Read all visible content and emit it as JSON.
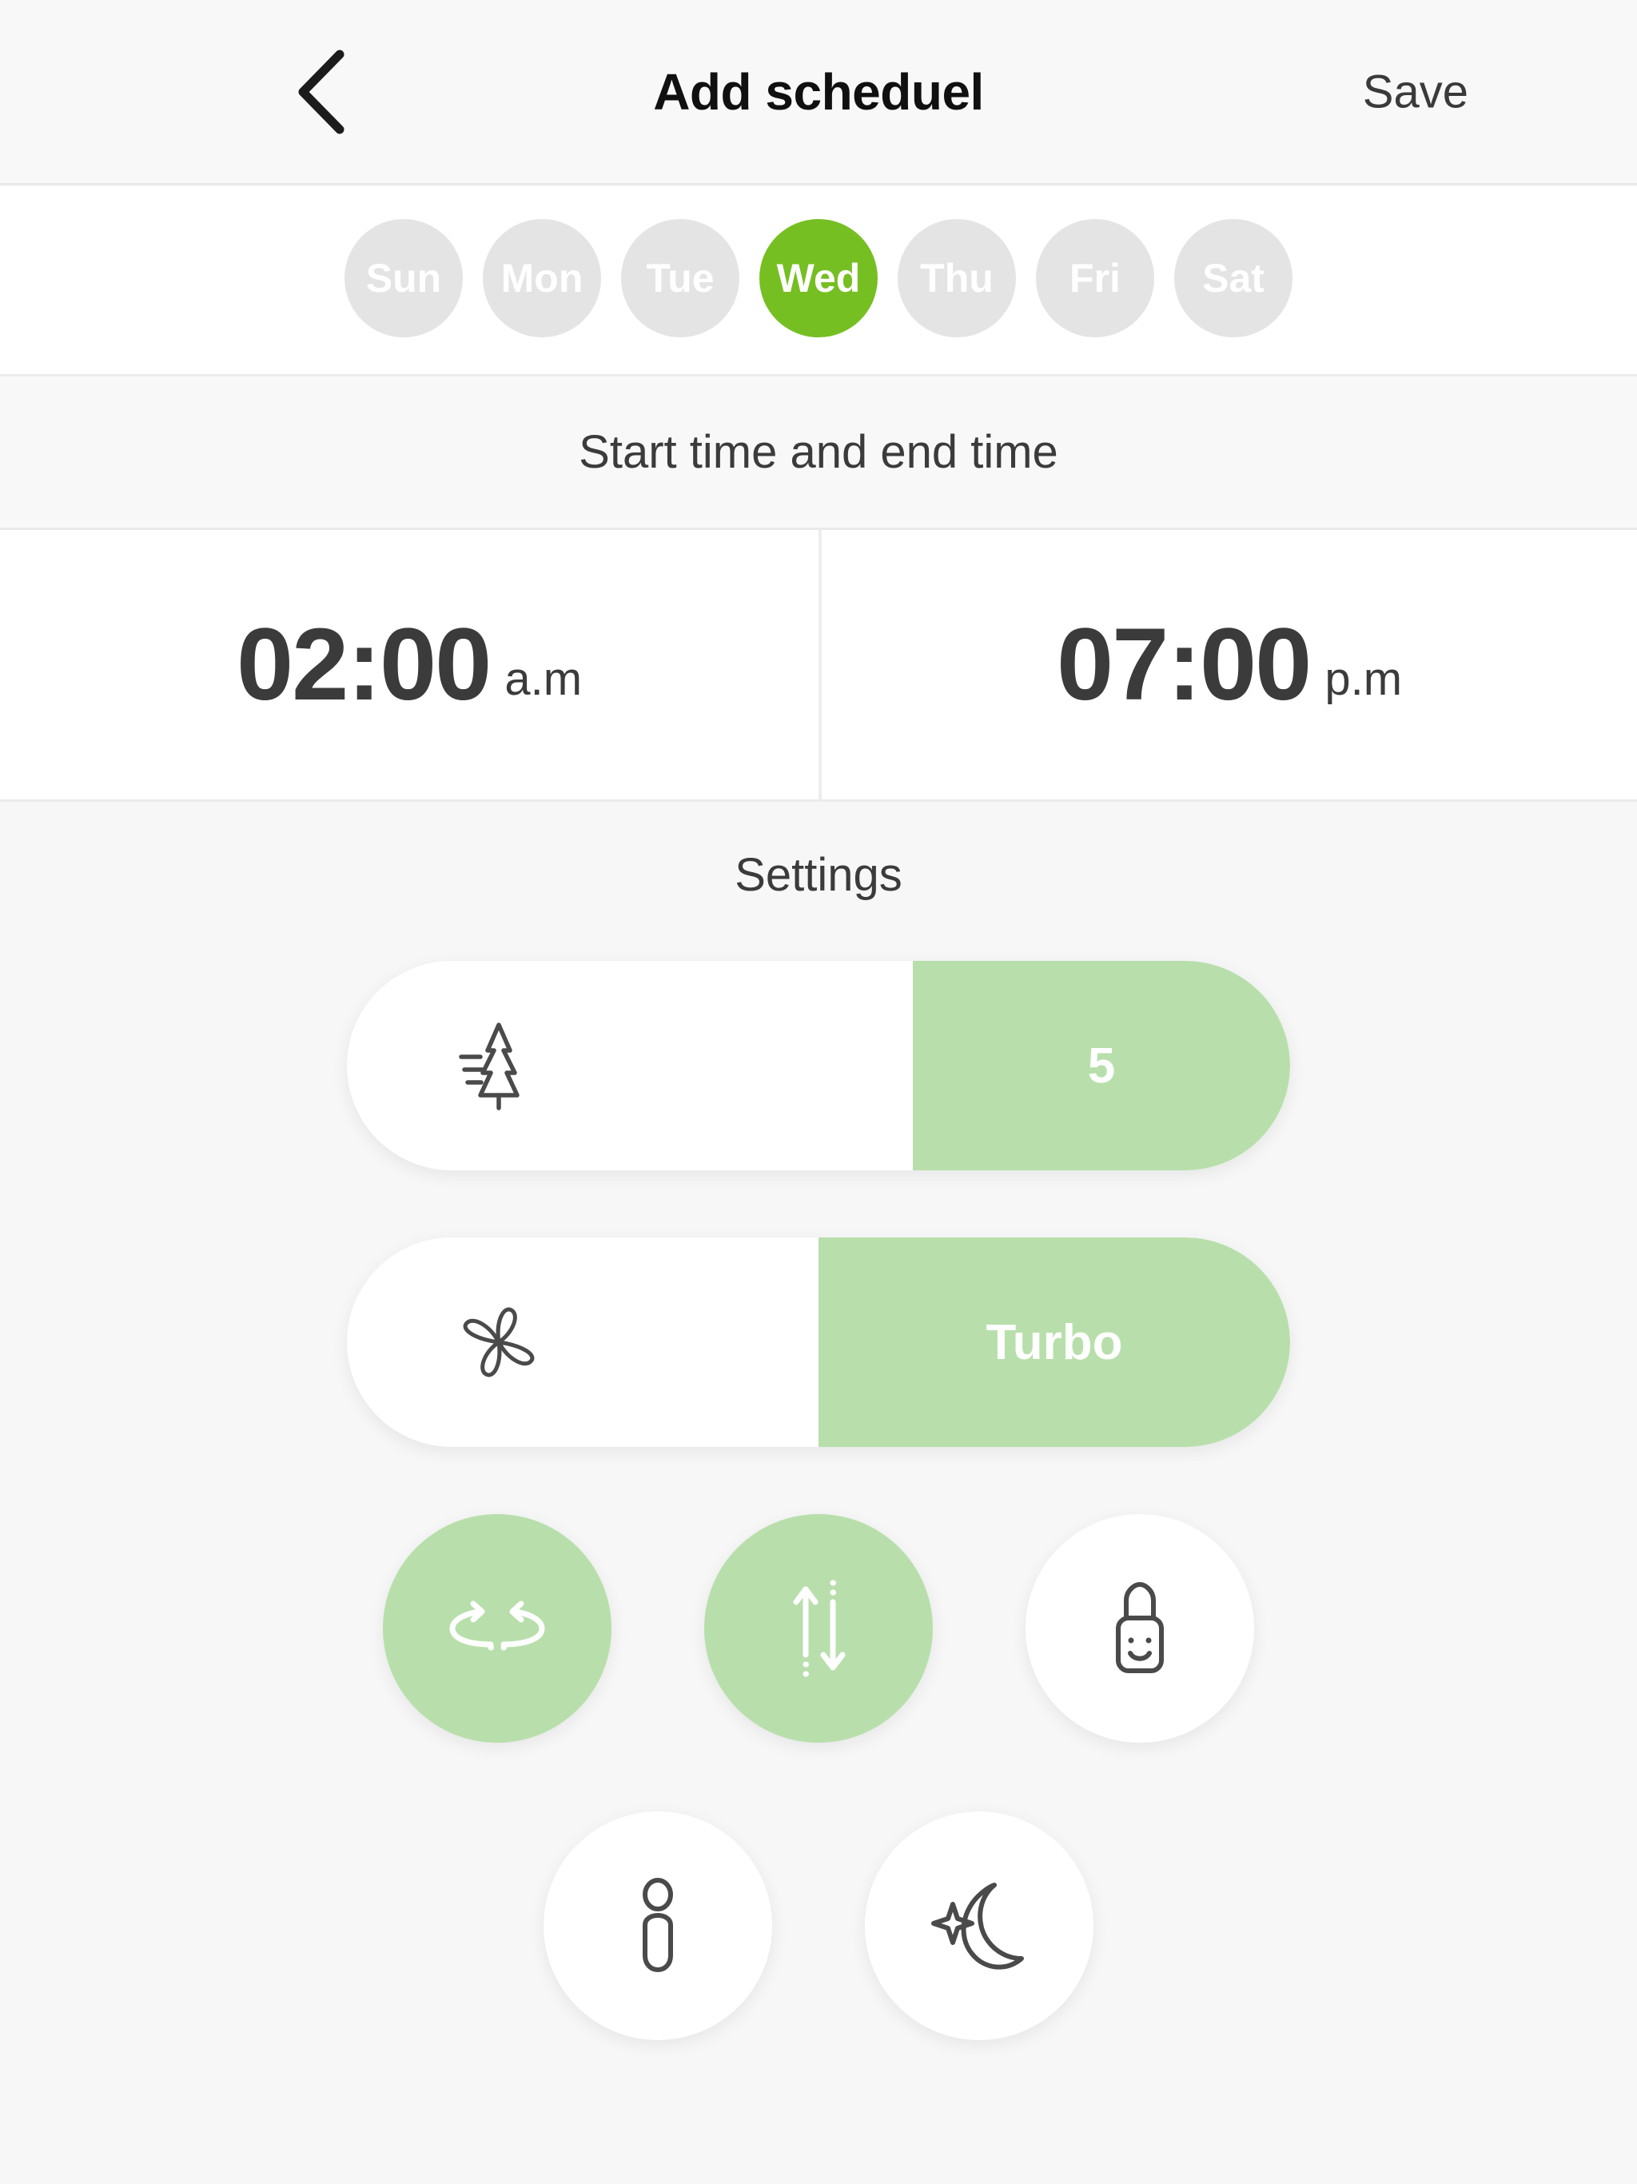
{
  "header": {
    "back_icon": "chevron-left-icon",
    "title": "Add scheduel",
    "save_label": "Save"
  },
  "days": {
    "items": [
      {
        "label": "Sun",
        "selected": false
      },
      {
        "label": "Mon",
        "selected": false
      },
      {
        "label": "Tue",
        "selected": false
      },
      {
        "label": "Wed",
        "selected": true
      },
      {
        "label": "Thu",
        "selected": false
      },
      {
        "label": "Fri",
        "selected": false
      },
      {
        "label": "Sat",
        "selected": false
      }
    ]
  },
  "time_section": {
    "label": "Start time and end time",
    "start": {
      "time": "02:00",
      "meridiem": "a.m"
    },
    "end": {
      "time": "07:00",
      "meridiem": "p.m"
    }
  },
  "settings": {
    "title": "Settings",
    "temperature_slider": {
      "icon": "pine-tree-icon",
      "value": "5",
      "fill_percent": 40
    },
    "fan_slider": {
      "icon": "fan-blades-icon",
      "value": "Turbo",
      "fill_percent": 50
    },
    "toggles_row_1": [
      {
        "icon": "horizontal-swing-icon",
        "active": true
      },
      {
        "icon": "vertical-swing-icon",
        "active": true
      },
      {
        "icon": "child-lock-icon",
        "active": false
      }
    ],
    "toggles_row_2": [
      {
        "icon": "follow-me-person-icon",
        "active": false
      },
      {
        "icon": "sleep-moon-icon",
        "active": false
      }
    ]
  },
  "colors": {
    "accent_green": "#76bf22",
    "soft_green": "#b8dfab",
    "inactive_gray": "#e4e4e4",
    "page_bg": "#f7f7f7",
    "card_bg": "#ffffff",
    "text_dark": "#3b3b3b"
  }
}
